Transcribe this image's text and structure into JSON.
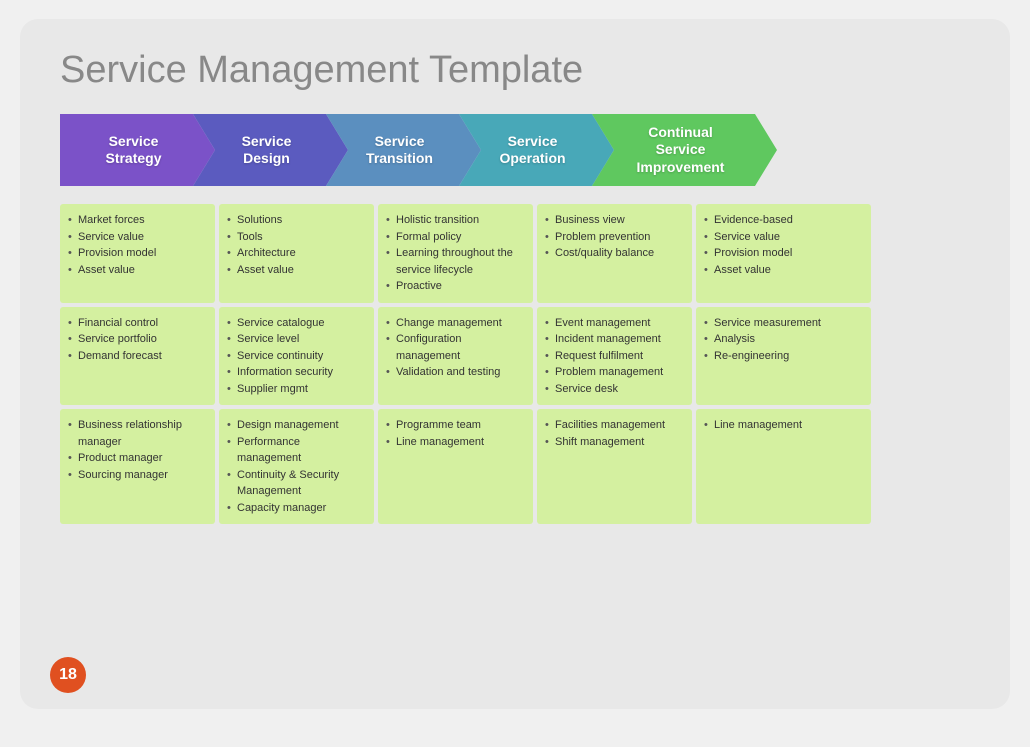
{
  "title": "Service Management Template",
  "arrows": [
    {
      "id": "strategy",
      "label": "Service\nStrategy",
      "color": "#7B52C8"
    },
    {
      "id": "design",
      "label": "Service\nDesign",
      "color": "#5B5BBF"
    },
    {
      "id": "transition",
      "label": "Service\nTransition",
      "color": "#5B8FBF"
    },
    {
      "id": "operation",
      "label": "Service\nOperation",
      "color": "#48A8B8"
    },
    {
      "id": "improvement",
      "label": "Continual\nService\nImprovement",
      "color": "#5FC85F"
    }
  ],
  "rows": [
    [
      [
        "Market forces",
        "Service value",
        "Provision model",
        "Asset value"
      ],
      [
        "Solutions",
        "Tools",
        "Architecture",
        "Asset value"
      ],
      [
        "Holistic transition",
        "Formal policy",
        "Learning throughout the service lifecycle",
        "Proactive"
      ],
      [
        "Business view",
        "Problem prevention",
        "Cost/quality balance"
      ],
      [
        "Evidence-based",
        "Service value",
        "Provision model",
        "Asset value"
      ]
    ],
    [
      [
        "Financial control",
        "Service portfolio",
        "Demand forecast"
      ],
      [
        "Service catalogue",
        "Service level",
        "Service continuity",
        "Information security",
        "Supplier mgmt"
      ],
      [
        "Change management",
        "Configuration management",
        "Validation and testing"
      ],
      [
        "Event management",
        "Incident management",
        "Request fulfilment",
        "Problem management",
        "Service desk"
      ],
      [
        "Service measurement",
        "Analysis",
        "Re-engineering"
      ]
    ],
    [
      [
        "Business relationship manager",
        "Product manager",
        "Sourcing manager"
      ],
      [
        "Design management",
        "Performance management",
        "Continuity & Security Management",
        "Capacity manager"
      ],
      [
        "Programme team",
        "Line management"
      ],
      [
        "Facilities management",
        "Shift management"
      ],
      [
        "Line management"
      ]
    ]
  ],
  "page_number": "18"
}
